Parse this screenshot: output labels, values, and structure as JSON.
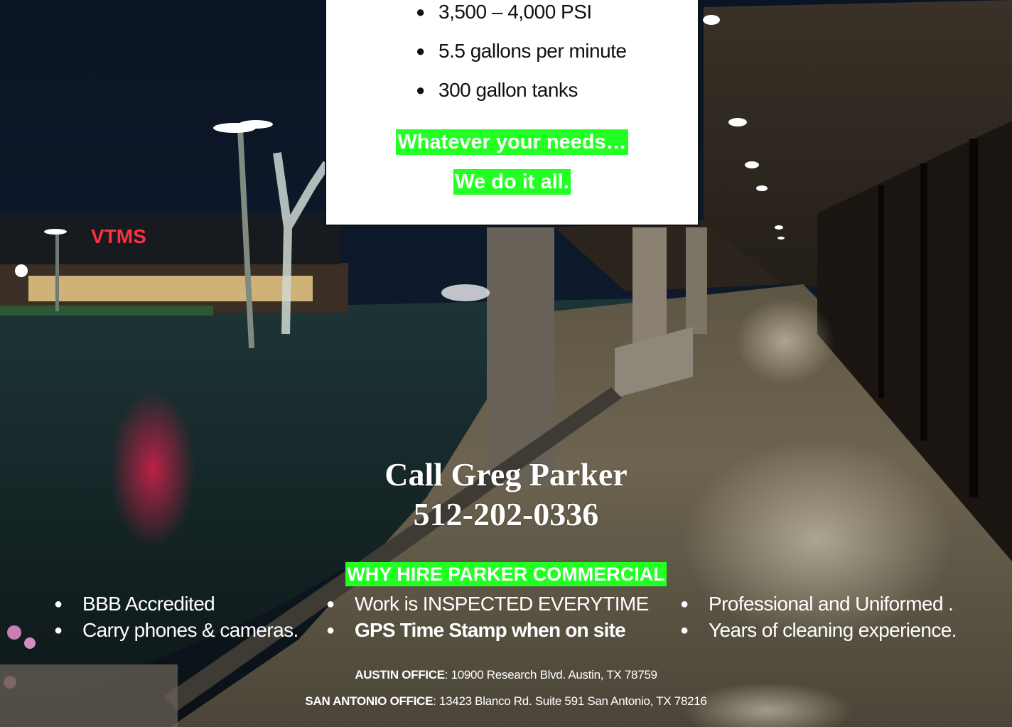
{
  "card": {
    "specs": [
      "3,500 – 4,000 PSI",
      "5.5 gallons per minute",
      "300 gallon tanks"
    ],
    "bullet_glyph": "●",
    "tagline_1": "Whatever your needs…",
    "tagline_2": "We do it all."
  },
  "contact": {
    "call_line": "Call Greg Parker",
    "phone": "512-202-0336"
  },
  "why": {
    "heading": "WHY HIRE PARKER COMMERCIAL",
    "col1": [
      "BBB Accredited",
      "Carry phones & cameras."
    ],
    "col2": [
      "Work is INSPECTED EVERYTIME",
      "GPS Time Stamp when on site"
    ],
    "col3": [
      "Professional and Uniformed .",
      "Years of cleaning experience."
    ]
  },
  "offices": {
    "austin_label": "AUSTIN OFFICE",
    "austin_address": ": 10900 Research Blvd. Austin, TX 78759",
    "sa_label": "SAN ANTONIO OFFICE",
    "sa_address": ": 13423 Blanco Rd. Suite 591 San Antonio, TX 78216"
  },
  "colors": {
    "highlight": "#22ff22",
    "card_bg": "#ffffff",
    "text_on_photo": "#ffffff"
  }
}
